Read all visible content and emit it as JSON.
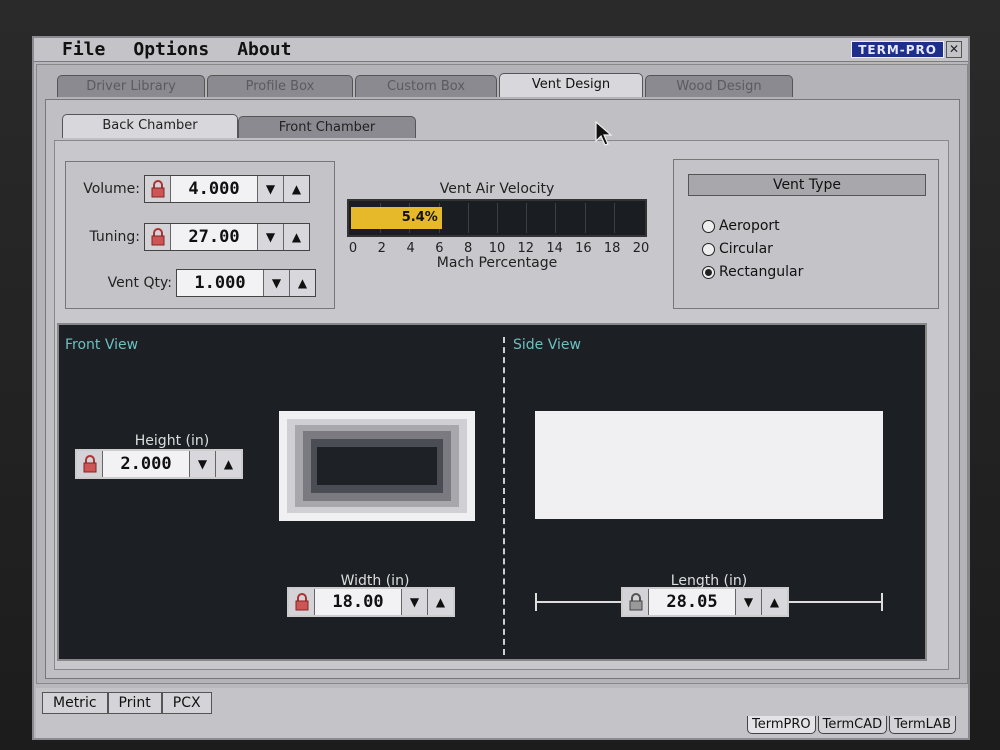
{
  "menu": {
    "file": "File",
    "options": "Options",
    "about": "About"
  },
  "brand": "TERM-PRO",
  "close": "✕",
  "tabs": [
    {
      "label": "Driver Library",
      "active": false
    },
    {
      "label": "Profile Box",
      "active": false
    },
    {
      "label": "Custom Box",
      "active": false
    },
    {
      "label": "Vent Design",
      "active": true
    },
    {
      "label": "Wood Design",
      "active": false
    }
  ],
  "subtabs": [
    {
      "label": "Back Chamber",
      "active": true
    },
    {
      "label": "Front Chamber",
      "active": false
    }
  ],
  "params": {
    "volume_label": "Volume:",
    "volume_value": "4.000",
    "tuning_label": "Tuning:",
    "tuning_value": "27.00",
    "ventqty_label": "Vent Qty:",
    "ventqty_value": "1.000"
  },
  "velocity": {
    "title": "Vent Air Velocity",
    "value_text": "5.4%",
    "value": 5.4,
    "max": 20,
    "ticks": [
      "0",
      "2",
      "4",
      "6",
      "8",
      "10",
      "12",
      "14",
      "16",
      "18",
      "20"
    ],
    "unit": "Mach Percentage",
    "fill_color": "#e6b92a"
  },
  "vent_type": {
    "title": "Vent Type",
    "options": [
      {
        "label": "Aeroport",
        "selected": false
      },
      {
        "label": "Circular",
        "selected": false
      },
      {
        "label": "Rectangular",
        "selected": true
      }
    ]
  },
  "views": {
    "front_title": "Front View",
    "side_title": "Side View",
    "height_label": "Height (in)",
    "height_value": "2.000",
    "width_label": "Width (in)",
    "width_value": "18.00",
    "length_label": "Length (in)",
    "length_value": "28.05"
  },
  "bottom": {
    "tabs": [
      "Metric",
      "Print",
      "PCX"
    ],
    "status_tabs": [
      "TermPRO",
      "TermCAD",
      "TermLAB"
    ]
  },
  "arrows": {
    "down": "▼",
    "up": "▲"
  }
}
